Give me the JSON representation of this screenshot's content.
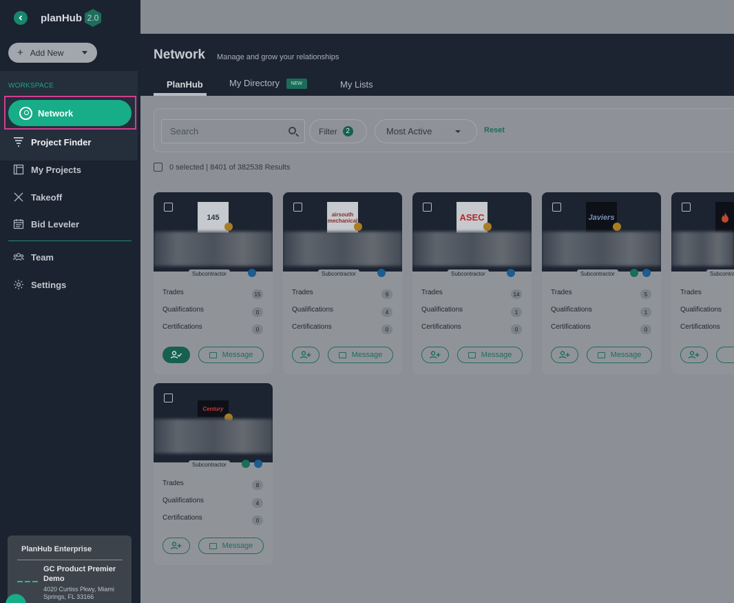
{
  "app": {
    "brand": "planHub",
    "version": "2.0"
  },
  "sidebar": {
    "add_new_label": "Add New",
    "workspace_label": "WORKSPACE",
    "items": [
      {
        "label": "Network",
        "icon": "user-circle-icon",
        "active": true
      },
      {
        "label": "Project Finder",
        "icon": "funnel-stack-icon"
      },
      {
        "label": "My Projects",
        "icon": "folder-pages-icon"
      },
      {
        "label": "Takeoff",
        "icon": "ruler-cross-icon"
      },
      {
        "label": "Bid Leveler",
        "icon": "calendar-list-icon"
      },
      {
        "label": "Team",
        "icon": "team-icon"
      },
      {
        "label": "Settings",
        "icon": "gear-icon"
      }
    ],
    "enterprise": {
      "title": "PlanHub Enterprise",
      "company": "GC Product Premier Demo",
      "address": "4020 Curtiss Pkwy, Miami Springs, FL 33166"
    }
  },
  "header": {
    "title": "Network",
    "subtitle": "Manage and grow your relationships",
    "tabs": [
      {
        "label": "PlanHub",
        "active": true
      },
      {
        "label": "My Directory",
        "badge": "NEW"
      },
      {
        "label": "My Lists"
      }
    ]
  },
  "filters": {
    "search_placeholder": "Search",
    "filter_label": "Filter",
    "filter_count": "2",
    "sort_label": "Most Active",
    "reset_label": "Reset"
  },
  "results": {
    "summary": "0 selected | 8401 of 382538 Results"
  },
  "labels": {
    "trades": "Trades",
    "qualifications": "Qualifications",
    "certifications": "Certifications",
    "message": "Message",
    "role": "Subcontractor"
  },
  "cards": [
    {
      "logo_text": "145",
      "trades": "15",
      "qualifications": "0",
      "certifications": "0",
      "connected": true
    },
    {
      "logo_text": "airsouth mechanical",
      "trades": "9",
      "qualifications": "4",
      "certifications": "0",
      "connected": false
    },
    {
      "logo_text": "ASEC",
      "trades": "14",
      "qualifications": "1",
      "certifications": "0",
      "connected": false
    },
    {
      "logo_text": "Javiers",
      "trades": "5",
      "qualifications": "1",
      "certifications": "0",
      "connected": false
    },
    {
      "logo_text": "",
      "trades": "",
      "qualifications": "",
      "certifications": "",
      "connected": false
    },
    {
      "logo_text": "Century",
      "trades": "8",
      "qualifications": "4",
      "certifications": "0",
      "connected": false
    }
  ],
  "colors": {
    "accent": "#17ad88",
    "highlight": "#d0408f",
    "sidebar": "#1b2330"
  }
}
